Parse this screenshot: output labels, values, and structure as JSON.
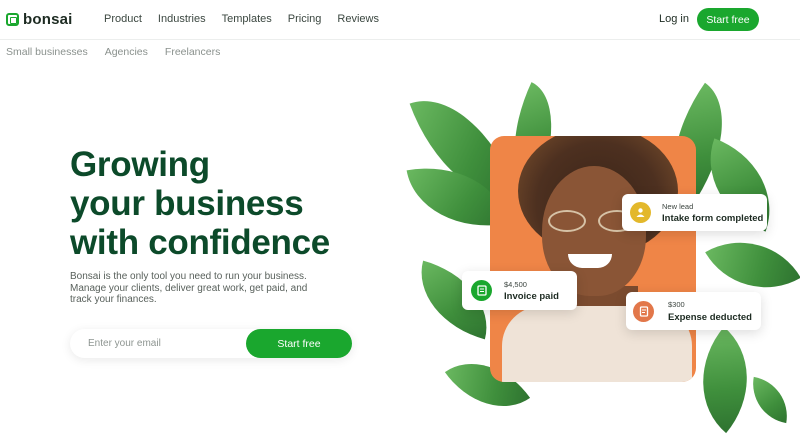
{
  "brand": {
    "name": "bonsai",
    "accent": "#1aa72e",
    "heading_color": "#0c4a2a"
  },
  "nav": {
    "links": [
      "Product",
      "Industries",
      "Templates",
      "Pricing",
      "Reviews"
    ],
    "login": "Log in",
    "cta": "Start free"
  },
  "subnav": [
    "Small businesses",
    "Agencies",
    "Freelancers"
  ],
  "hero": {
    "headline_lines": [
      "Growing",
      "your business",
      "with confidence"
    ],
    "subcopy": "Bonsai is the only tool you need to run your business. Manage your clients, deliver great work, get paid, and track your finances.",
    "email_placeholder": "Enter your email",
    "cta": "Start free"
  },
  "cards": {
    "intake": {
      "small": "New lead",
      "big": "Intake form completed",
      "icon": "user-icon",
      "color": "#e3b82b"
    },
    "invoice": {
      "small": "$4,500",
      "big": "Invoice paid",
      "icon": "invoice-icon",
      "color": "#1aa72e"
    },
    "expense": {
      "small": "$300",
      "big": "Expense deducted",
      "icon": "receipt-icon",
      "color": "#e2774a"
    }
  }
}
